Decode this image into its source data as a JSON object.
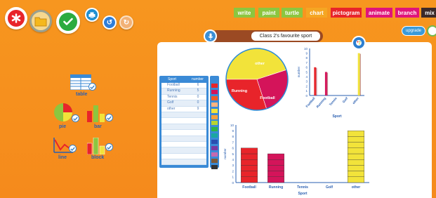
{
  "toolbar": {
    "new_icon": "asterisk-icon",
    "open_icon": "folder-icon",
    "done_icon": "check-icon",
    "print_icon": "printer-icon",
    "undo_label": "↺",
    "redo_label": "↻"
  },
  "tabs": [
    {
      "label": "write",
      "color": "#8cc63f"
    },
    {
      "label": "paint",
      "color": "#8cc63f"
    },
    {
      "label": "turtle",
      "color": "#8cc63f"
    },
    {
      "label": "chart",
      "color": "#f5a623"
    },
    {
      "label": "pictogram",
      "color": "#e8242a"
    },
    {
      "label": "animate",
      "color": "#e0147a"
    },
    {
      "label": "branch",
      "color": "#e0147a"
    },
    {
      "label": "mix",
      "color": "#3b2a2a"
    }
  ],
  "upgrade_label": "upgrade",
  "chart_title": "Class 2's favourite sport",
  "tools": {
    "table_label": "table",
    "pie_label": "pie",
    "bar_label": "bar",
    "line_label": "line",
    "block_label": "block"
  },
  "data_table": {
    "col_sport": "Sport",
    "col_number": "number",
    "rows": [
      {
        "sport": "Football",
        "number": "6",
        "color": "#e8242a"
      },
      {
        "sport": "Running",
        "number": "5",
        "color": "#d4145a"
      },
      {
        "sport": "Tennis",
        "number": "0",
        "color": "#f15a24"
      },
      {
        "sport": "Golf",
        "number": "0",
        "color": "#ffb380"
      },
      {
        "sport": "other",
        "number": "9",
        "color": "#f2e33a"
      },
      {
        "sport": "",
        "number": "",
        "color": "#f7a13b"
      },
      {
        "sport": "",
        "number": "",
        "color": "#b8d432"
      },
      {
        "sport": "",
        "number": "",
        "color": "#2db34a"
      },
      {
        "sport": "",
        "number": "",
        "color": "#1ba7a0"
      },
      {
        "sport": "",
        "number": "",
        "color": "#2a4fb0"
      },
      {
        "sport": "",
        "number": "",
        "color": "#7a3aa0"
      },
      {
        "sport": "",
        "number": "",
        "color": "#c36ab0"
      },
      {
        "sport": "",
        "number": "",
        "color": "#7c5a3a"
      },
      {
        "sport": "",
        "number": "",
        "color": "#333333"
      }
    ]
  },
  "chart_data": [
    {
      "type": "pie",
      "categories": [
        "other",
        "Running",
        "Football"
      ],
      "values": [
        9,
        5,
        6
      ],
      "colors": [
        "#f2e33a",
        "#d4145a",
        "#e8242a"
      ]
    },
    {
      "type": "bar",
      "categories": [
        "Football",
        "Running",
        "Tennis",
        "Golf",
        "other"
      ],
      "values": [
        6,
        5,
        0,
        0,
        9
      ],
      "colors": [
        "#e8242a",
        "#d4145a",
        "#f15a24",
        "#ffb380",
        "#f2e33a"
      ],
      "xlabel": "Sport",
      "ylabel": "number",
      "ylim": [
        0,
        10
      ],
      "yticks": [
        "0",
        "1",
        "2",
        "3",
        "4",
        "5",
        "6",
        "7",
        "8",
        "9",
        "10"
      ]
    },
    {
      "type": "bar",
      "style": "block",
      "categories": [
        "Football",
        "Running",
        "Tennis",
        "Golf",
        "other"
      ],
      "values": [
        6,
        5,
        0,
        0,
        9
      ],
      "colors": [
        "#e8242a",
        "#d4145a",
        "#f15a24",
        "#ffb380",
        "#f2e33a"
      ],
      "xlabel": "Sport",
      "ylabel": "number",
      "ylim": [
        0,
        10
      ],
      "yticks": [
        "0",
        "1",
        "2",
        "3",
        "4",
        "5",
        "6",
        "7",
        "8",
        "9",
        "10"
      ]
    }
  ]
}
